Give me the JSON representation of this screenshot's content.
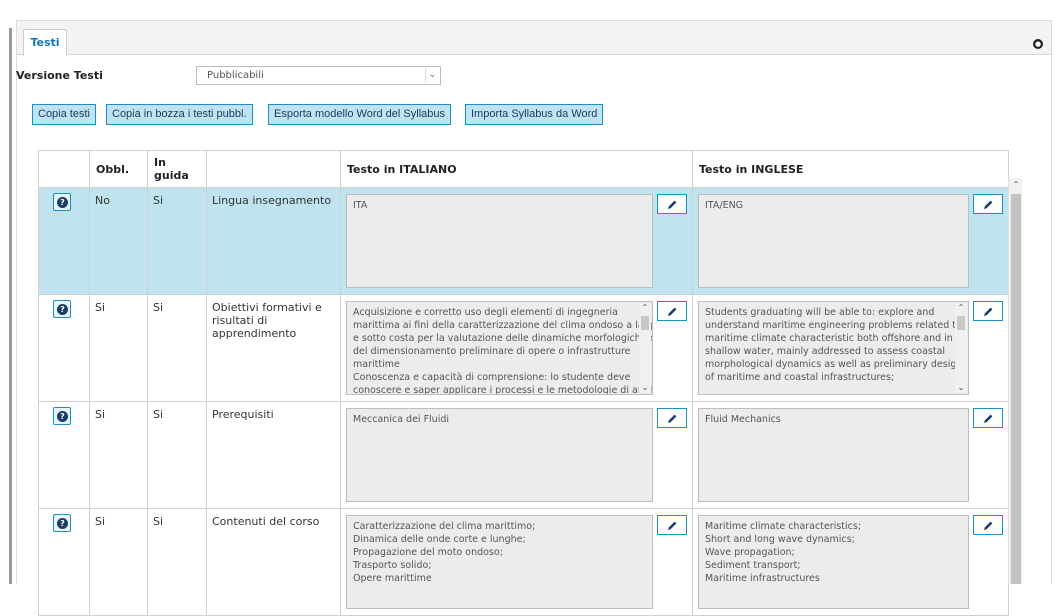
{
  "tabs": [
    {
      "label": "Testi"
    }
  ],
  "form": {
    "version_label": "Versione Testi",
    "version_value": "Pubblicabili"
  },
  "toolbar": {
    "copy_texts": "Copia testi",
    "copy_draft": "Copia in bozza i testi pubbl.",
    "export_word": "Esporta modello Word del Syllabus",
    "import_word": "Importa Syllabus da Word"
  },
  "table": {
    "headers": [
      "",
      "Obbl.",
      "In guida",
      "",
      "Testo in ITALIANO",
      "Testo in INGLESE"
    ],
    "rows": [
      {
        "obbl": "No",
        "guida": "Si",
        "label": "Lingua insegnamento",
        "it": [
          "ITA"
        ],
        "en": [
          "ITA/ENG"
        ]
      },
      {
        "obbl": "Si",
        "guida": "Si",
        "label": "Obiettivi formativi e risultati di apprendimento",
        "it": [
          "Acquisizione e corretto uso degli elementi di ingegneria",
          "marittima ai fini della caratterizzazione del clima ondoso a largo",
          "e sotto costa per la valutazione delle dinamiche morfologiche e",
          "del dimensionamento preliminare di opere o infrastrutture",
          "marittime",
          "Conoscenza e capacità di comprensione: lo studente deve",
          "conoscere e saper applicare i processi e le metodologie di anali"
        ],
        "en": [
          "Students graduating will be able to: explore and",
          "understand maritime engineering problems related to",
          "maritime climate characteristic both offshore and in",
          "shallow water, mainly addressed to assess coastal",
          "morphological dynamics as well as preliminary design",
          "of maritime and coastal infrastructures;"
        ]
      },
      {
        "obbl": "Si",
        "guida": "Si",
        "label": "Prerequisiti",
        "it": [
          "Meccanica dei Fluidi"
        ],
        "en": [
          "Fluid Mechanics"
        ]
      },
      {
        "obbl": "Si",
        "guida": "Si",
        "label": "Contenuti del corso",
        "it": [
          "Caratterizzazione del clima marittimo;",
          "Dinamica delle onde corte e lunghe;",
          "Propagazione del moto ondoso;",
          "Trasporto solido;",
          "Opere marittime"
        ],
        "en": [
          "Maritime climate characteristics;",
          "Short and long wave dynamics;",
          "Wave propagation;",
          "Sediment transport;",
          "Maritime infrastructures"
        ]
      }
    ]
  },
  "icons": {
    "collapse": "collapse-circle-icon",
    "help": "question-circle-icon",
    "edit": "pencil-icon",
    "dropdown": "chevron-down-icon"
  },
  "colors": {
    "accent": "#1b8fc2",
    "button_bg": "#bfe3f3",
    "selected_row": "#bfe3ef",
    "tab_text": "#1678b5"
  }
}
